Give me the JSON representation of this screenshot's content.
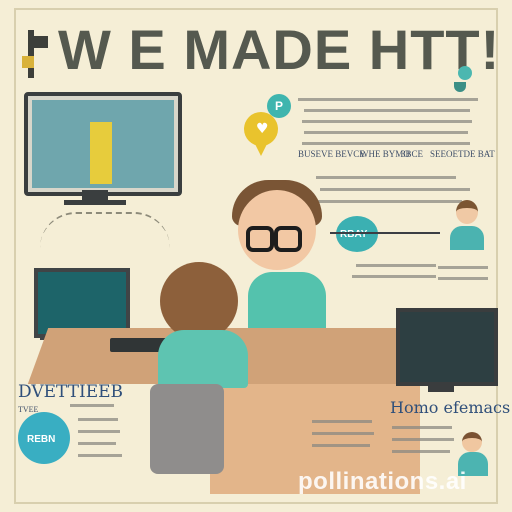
{
  "title": "W E MADE HTT!",
  "circles": {
    "top_logo": "P",
    "middle": "RBAY",
    "bottom_left": "REBN"
  },
  "labels": {
    "row_1": "BUSEVE BEVCE",
    "row_2": "WHE BYMO",
    "row_3": "3BCE",
    "row_4": "SEEOE",
    "row_5": "TDE BAT",
    "bottom_left_heading": "DVETTIEEB",
    "bottom_left_small": "TVEE",
    "bottom_right_heading": "Homo efemacs"
  },
  "watermark": "pollinations.ai",
  "colors": {
    "background": "#f5eed6",
    "teal": "#3fb5ae",
    "yellow": "#e9c32d",
    "dark": "#3a3e3f"
  },
  "icons": {
    "speech_bubble": "speech-bubble-icon",
    "flag": "flag-icon",
    "heart": "heart-icon"
  }
}
